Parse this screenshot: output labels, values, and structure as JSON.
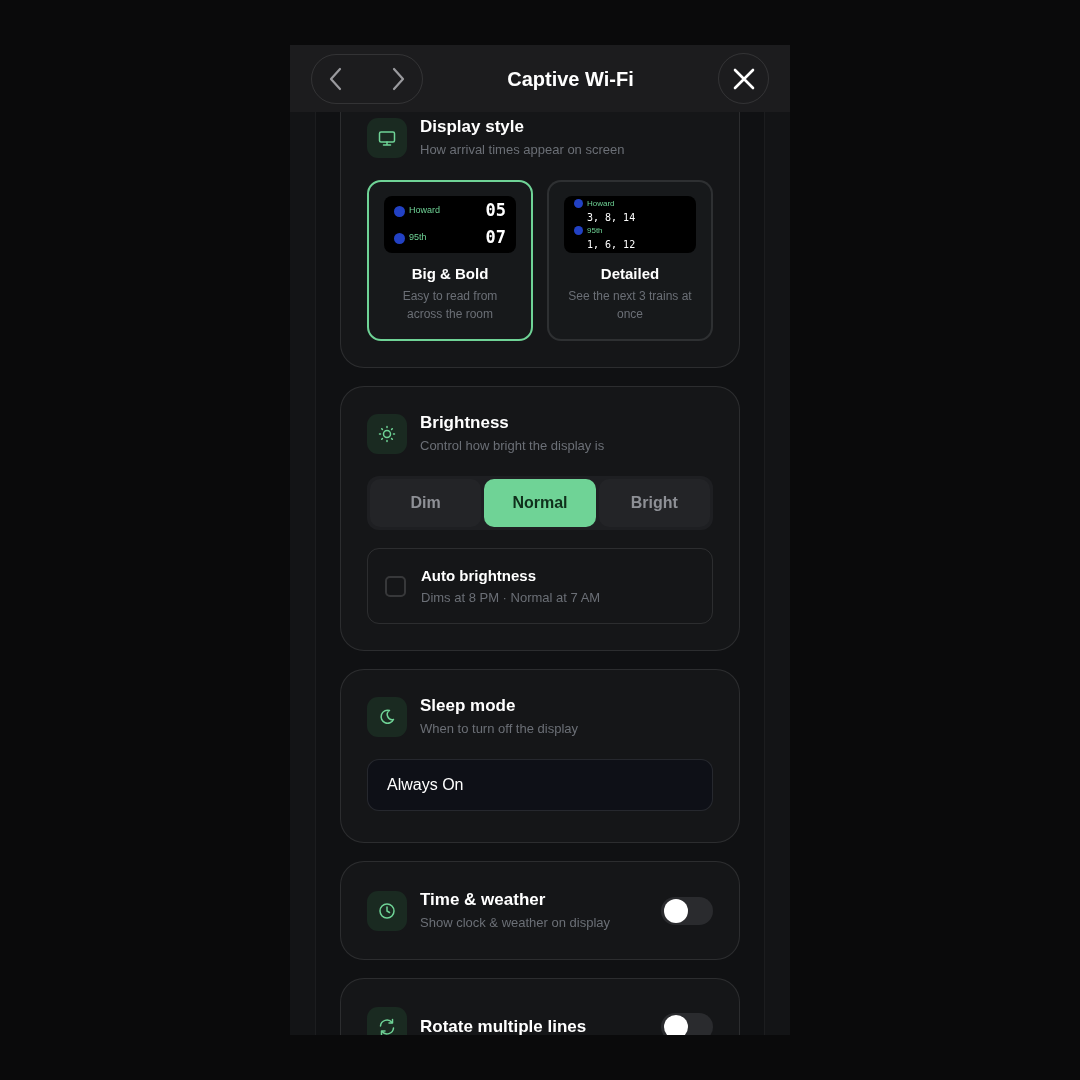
{
  "header": {
    "title": "Captive Wi-Fi"
  },
  "sections": [
    {
      "kind": "options",
      "title": "Display style",
      "subtitle": "How arrival times appear on screen",
      "options": [
        {
          "label": "Big & Bold",
          "description": "Easy to read from across the room",
          "selected": true,
          "preview": {
            "kind": "big",
            "rows": [
              {
                "station": "Howard",
                "times": "05"
              },
              {
                "station": "95th",
                "times": "07"
              }
            ]
          }
        },
        {
          "label": "Detailed",
          "description": "See the next 3 trains at once",
          "selected": false,
          "preview": {
            "kind": "detailed",
            "rows": [
              {
                "station": "Howard",
                "times": "3, 8, 14"
              },
              {
                "station": "95th",
                "times": "1, 6, 12"
              }
            ]
          }
        }
      ]
    },
    {
      "kind": "segmented",
      "title": "Brightness",
      "subtitle": "Control how bright the display is",
      "segments": [
        {
          "label": "Dim",
          "selected": false
        },
        {
          "label": "Normal",
          "selected": true
        },
        {
          "label": "Bright",
          "selected": false
        }
      ],
      "checkbox": {
        "label": "Auto brightness",
        "sublabel": "Dims at 8 PM · Normal at 7 AM",
        "checked": false
      }
    },
    {
      "kind": "select",
      "title": "Sleep mode",
      "subtitle": "When to turn off the display",
      "value": "Always On"
    },
    {
      "kind": "toggle",
      "title": "Time & weather",
      "subtitle": "Show clock & weather on display",
      "on": false
    },
    {
      "kind": "toggle",
      "title": "Rotate multiple lines",
      "on": false
    }
  ]
}
